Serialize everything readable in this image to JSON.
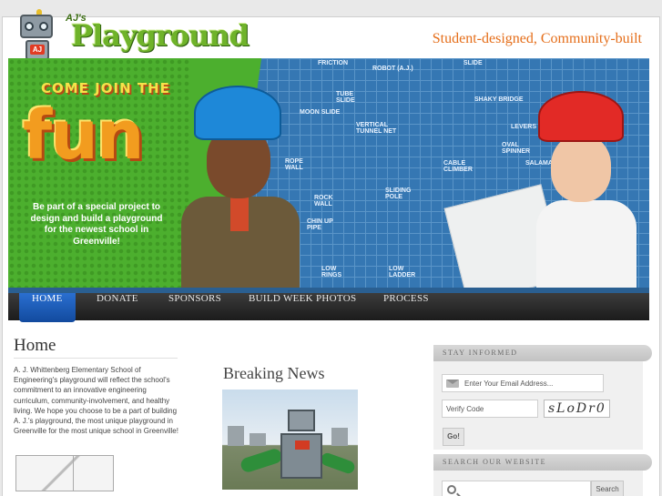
{
  "header": {
    "logo_small": "AJ's",
    "logo_title": "Playground",
    "logo_plate": "AJ",
    "tagline": "Student-designed, Community-built"
  },
  "banner": {
    "headline": "COME JOIN THE",
    "big_word": "fun",
    "text": "Be part of a special project to design and build a playground for the newest school in Greenville!",
    "blueprint_labels": [
      "FRICTION",
      "ROBOT (A.J.)",
      "SLIDE",
      "TUBE SLIDE",
      "SHAKY BRIDGE",
      "MOON SLIDE",
      "VERTICAL TUNNEL NET",
      "LEVERS",
      "ROPE WALL",
      "ROCK WALL",
      "SLIDING POLE",
      "CABLE CLIMBER",
      "CHIN UP PIPE",
      "LOW RINGS",
      "LOW LADDER",
      "OVAL SPINNER",
      "SALAMA..."
    ]
  },
  "nav": {
    "items": [
      "HOME",
      "DONATE",
      "SPONSORS",
      "BUILD WEEK PHOTOS",
      "PROCESS"
    ]
  },
  "home": {
    "title": "Home",
    "body": "A. J. Whittenberg Elementary School of Engineering's playground will reflect the school's commitment to an innovative engineering curriculum, community-involvement, and healthy living.  We hope you choose to be a part of building A. J.'s playground, the most unique playground in Greenville for the most unique school in Greenville!"
  },
  "news": {
    "title": "Breaking News"
  },
  "sidebar": {
    "stay_informed": {
      "heading": "STAY INFORMED",
      "email_placeholder": "Enter Your Email Address...",
      "verify_placeholder": "Verify Code",
      "captcha": "sLoDr0",
      "go_label": "Go!"
    },
    "search": {
      "heading": "SEARCH OUR WEBSITE",
      "button_label": "Search"
    }
  },
  "colors": {
    "accent_orange": "#e56e1a",
    "nav_active": "#1f62c4",
    "logo_green": "#6fb32a"
  }
}
